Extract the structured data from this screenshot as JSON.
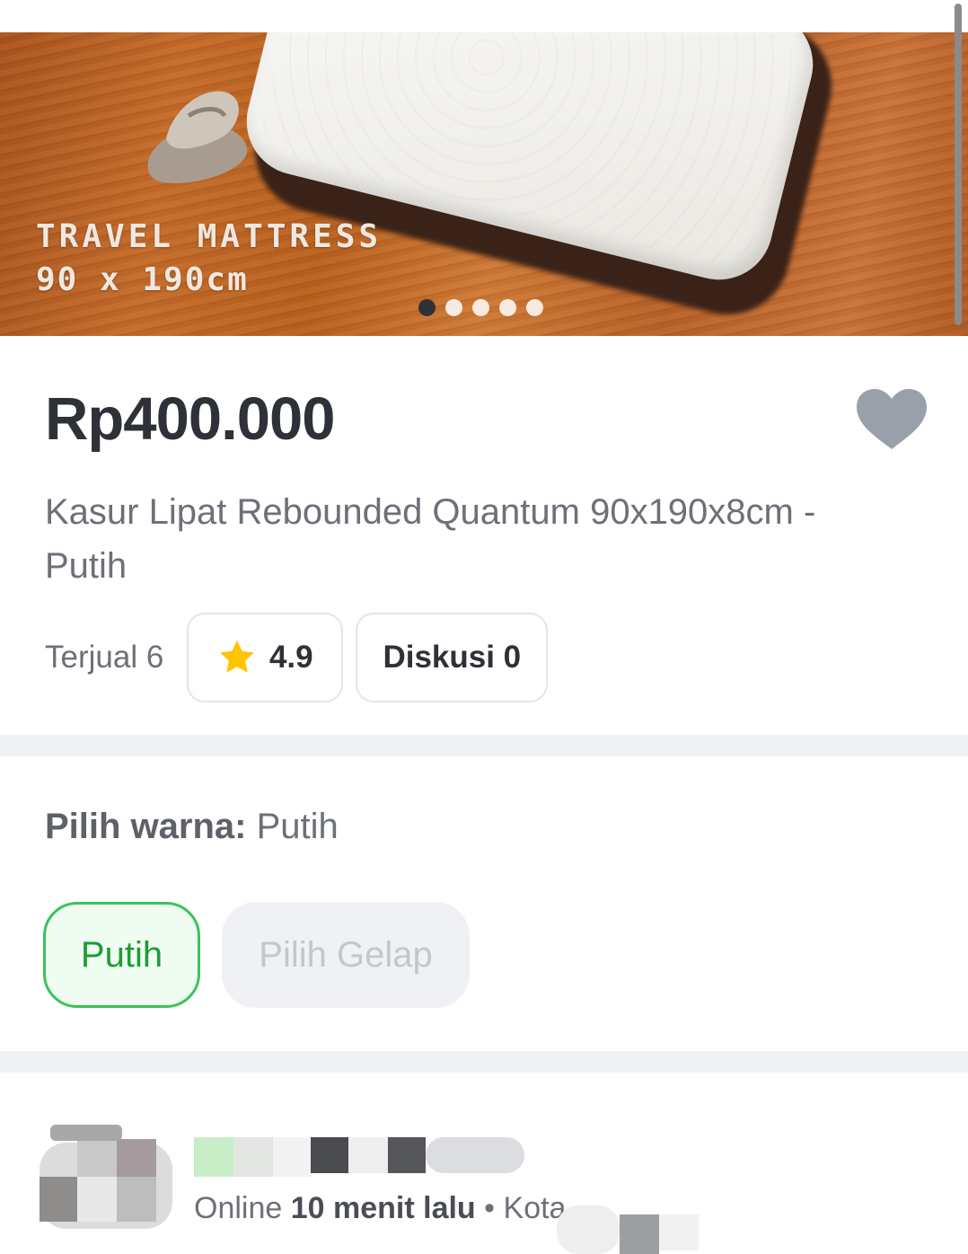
{
  "hero": {
    "line1": "TRAVEL MATTRESS",
    "line2": "90 x 190cm",
    "dot_count": 5,
    "active_dot": 1
  },
  "product": {
    "price": "Rp400.000",
    "title": "Kasur Lipat Rebounded Quantum 90x190x8cm - Putih",
    "sold": "Terjual 6",
    "rating": "4.9",
    "discussion": "Diskusi 0",
    "wishlist_icon": "heart-icon"
  },
  "variant": {
    "label": "Pilih warna:",
    "selected": "Putih",
    "options": [
      "Putih",
      "Pilih Gelap"
    ]
  },
  "shop": {
    "status_prefix": "Online",
    "status_time": "10 menit lalu",
    "status_sep": "•",
    "location_visible": "Kota"
  },
  "colors": {
    "price": "#2e3137",
    "accent_green": "#3cc35a",
    "selected_bg": "#eefcf1",
    "heart": "#9aa0aa",
    "star": "#ffc400",
    "separator": "#f0f1f4"
  }
}
